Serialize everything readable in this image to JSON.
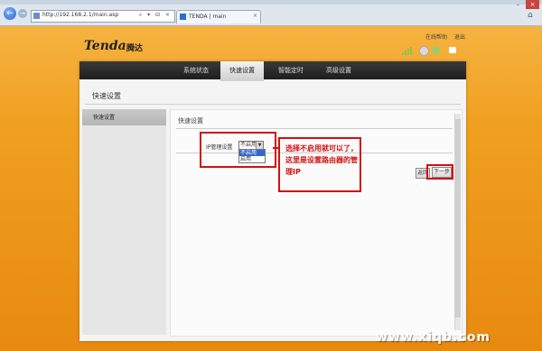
{
  "browser": {
    "address": "http://192.168.2.1/main.asp",
    "address_tools": "⌕ ▾ ⊟ ×",
    "tab_title": "TENDA | main",
    "tab_close": "×",
    "win_min": "–",
    "win_close": "×"
  },
  "header": {
    "logo": "Tenda",
    "logo_cn": "腾达",
    "links": [
      "在线帮助",
      "退出"
    ]
  },
  "menu": {
    "items": [
      "系统状态",
      "快速设置",
      "智能定时",
      "高级设置"
    ],
    "active_index": 1
  },
  "page": {
    "title": "快速设置",
    "left_item": "快速设置",
    "content_title": "快速设置"
  },
  "form": {
    "ip_label": "IP管理设置",
    "select_value": "不启用",
    "options": [
      "不启用",
      "启用"
    ],
    "back_label": "返回",
    "next_label": "下一步"
  },
  "annotation": {
    "note": "选择不启用就可以了，这里是设置路由器的管理IP",
    "color": "#d01010"
  },
  "watermark": "www.xiqb.com"
}
